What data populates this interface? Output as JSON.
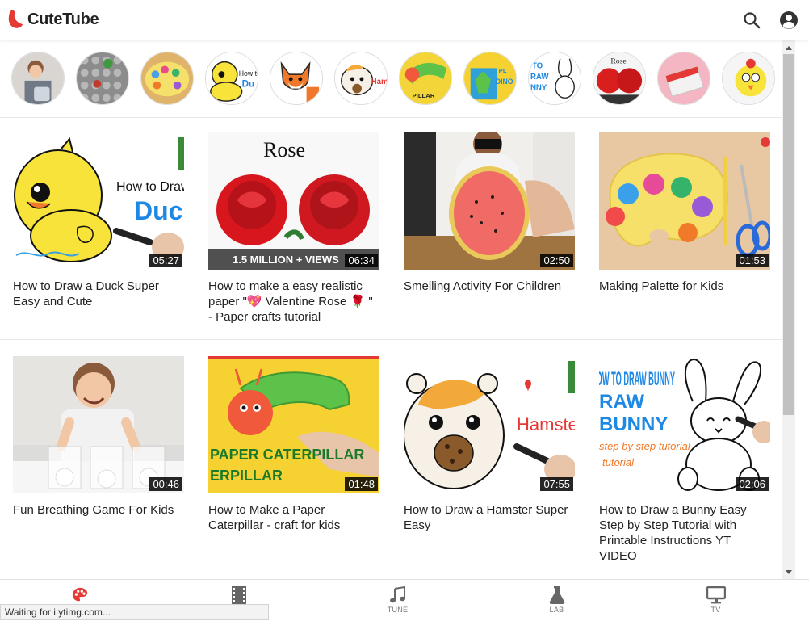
{
  "app": {
    "name": "CuteTube"
  },
  "header": {
    "search_icon": "search-icon",
    "account_icon": "account-circle-icon"
  },
  "channels": [
    {
      "name": "channel-1"
    },
    {
      "name": "channel-2"
    },
    {
      "name": "channel-3"
    },
    {
      "name": "channel-4"
    },
    {
      "name": "channel-5"
    },
    {
      "name": "channel-6"
    },
    {
      "name": "channel-7"
    },
    {
      "name": "channel-8"
    },
    {
      "name": "channel-9"
    },
    {
      "name": "channel-10"
    },
    {
      "name": "channel-11"
    },
    {
      "name": "channel-12"
    }
  ],
  "videos": [
    {
      "title": "How to Draw a Duck Super Easy and Cute",
      "duration": "05:27",
      "thumb_text": "How to Draw a Duck"
    },
    {
      "title": "How to make a easy realistic paper \"💖 Valentine Rose 🌹 \" - Paper crafts tutorial",
      "duration": "06:34",
      "thumb_text": "Rose",
      "thumb_caption": "1.5 MILLION + VIEWS"
    },
    {
      "title": "Smelling Activity For Children",
      "duration": "02:50"
    },
    {
      "title": "Making Palette for Kids",
      "duration": "01:53"
    },
    {
      "title": "Fun Breathing Game For Kids",
      "duration": "00:46"
    },
    {
      "title": "How to Make a Paper Caterpillar - craft for kids",
      "duration": "01:48",
      "thumb_text": "PAPER CATERPILLAR"
    },
    {
      "title": "How to Draw a Hamster Super Easy",
      "duration": "07:55",
      "thumb_text": "Hamster"
    },
    {
      "title": "How to Draw a Bunny Easy Step by Step Tutorial with Printable Instructions YT VIDEO",
      "duration": "02:06",
      "thumb_text": "HOW TO DRAW BUNNY",
      "thumb_sub": "step by step tutorial"
    }
  ],
  "bottom_nav": [
    {
      "label": "",
      "icon": "palette-icon",
      "active": true
    },
    {
      "label": "",
      "icon": "film-icon"
    },
    {
      "label": "TUNE",
      "icon": "music-note-icon"
    },
    {
      "label": "LAB",
      "icon": "flask-icon"
    },
    {
      "label": "TV",
      "icon": "tv-icon"
    }
  ],
  "status": {
    "text": "Waiting for i.ytimg.com..."
  },
  "colors": {
    "accent": "#e53935",
    "duration_bg": "#000000"
  }
}
